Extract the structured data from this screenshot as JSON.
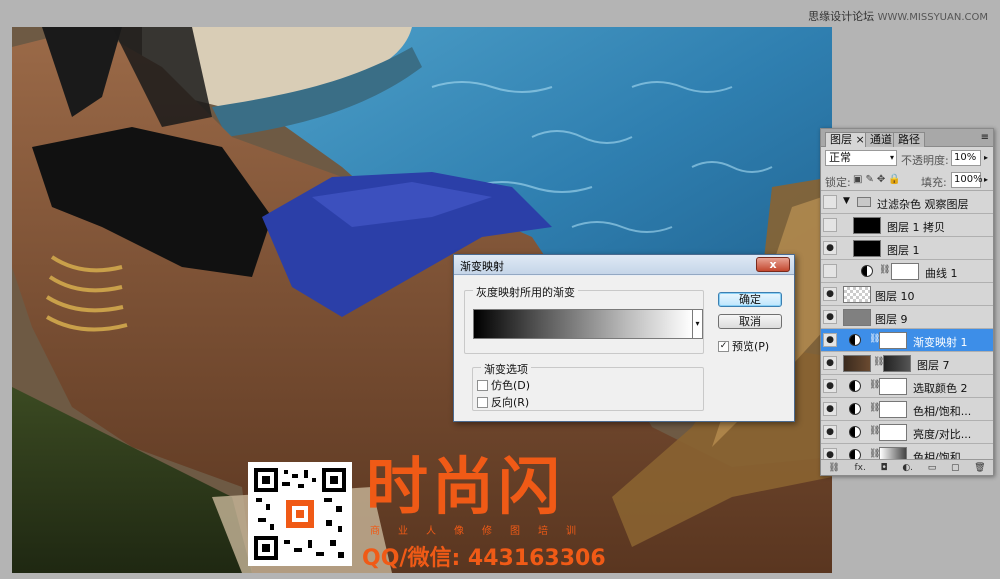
{
  "watermark": {
    "site_name": "思缘设计论坛",
    "url": "WWW.MISSYUAN.COM"
  },
  "dialog": {
    "title": "渐变映射",
    "close_label": "x",
    "gradient_group_label": "灰度映射所用的渐变",
    "options_group_label": "渐变选项",
    "dither_label": "仿色(D)",
    "reverse_label": "反向(R)",
    "ok_label": "确定",
    "cancel_label": "取消",
    "preview_label": "预览(P)",
    "preview_checked": true,
    "dither_checked": false,
    "reverse_checked": false
  },
  "layers_panel": {
    "tabs": [
      "图层",
      "通道",
      "路径"
    ],
    "tab_close": "×",
    "blend_mode": "正常",
    "opacity_label": "不透明度:",
    "opacity_value": "10%",
    "lock_label": "锁定:",
    "fill_label": "填充:",
    "fill_value": "100%",
    "layers": [
      {
        "name": "过滤杂色 观察图层",
        "type": "group",
        "visible": false
      },
      {
        "name": "图层 1 拷贝",
        "type": "pixel",
        "visible": false,
        "thumb_color": "#000000"
      },
      {
        "name": "图层 1",
        "type": "pixel",
        "visible": true,
        "thumb_color": "#000000"
      },
      {
        "name": "曲线 1",
        "type": "adjustment",
        "visible": false
      },
      {
        "name": "图层 10",
        "type": "pixel",
        "visible": true,
        "thumb_color": "checker"
      },
      {
        "name": "图层 9",
        "type": "pixel",
        "visible": true,
        "thumb_color": "#808080"
      },
      {
        "name": "渐变映射 1",
        "type": "adjustment",
        "visible": true,
        "selected": true
      },
      {
        "name": "图层 7",
        "type": "pixel",
        "visible": true,
        "thumb_color": "photo"
      },
      {
        "name": "选取颜色 2",
        "type": "adjustment",
        "visible": true
      },
      {
        "name": "色相/饱和...",
        "type": "adjustment",
        "visible": true
      },
      {
        "name": "亮度/对比...",
        "type": "adjustment",
        "visible": true
      },
      {
        "name": "色相/饱和...",
        "type": "adjustment",
        "visible": true
      }
    ]
  },
  "brand": {
    "title": "时尚闪",
    "subtitle": "商业人像修图培训",
    "qq": "QQ/微信:  443163306"
  }
}
